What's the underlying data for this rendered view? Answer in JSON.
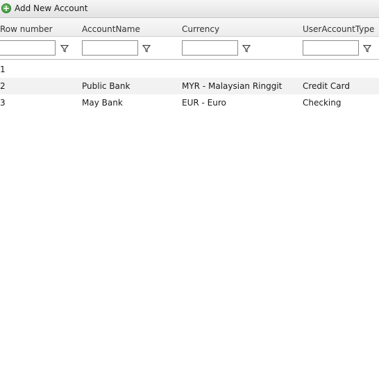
{
  "toolbar": {
    "add_label": "Add New Account",
    "add_icon": "plus-circle-icon"
  },
  "grid": {
    "columns": [
      {
        "key": "row_number",
        "label": "Row number"
      },
      {
        "key": "account_name",
        "label": "AccountName"
      },
      {
        "key": "currency",
        "label": "Currency"
      },
      {
        "key": "user_account_type",
        "label": "UserAccountType"
      }
    ],
    "filters": [
      "",
      "",
      "",
      ""
    ],
    "filter_icon": "funnel-icon",
    "rows": [
      {
        "row_number": "1",
        "account_name": "",
        "currency": "",
        "user_account_type": ""
      },
      {
        "row_number": "2",
        "account_name": "Public Bank",
        "currency": "MYR - Malaysian Ringgit",
        "user_account_type": "Credit Card"
      },
      {
        "row_number": "3",
        "account_name": "May Bank",
        "currency": "EUR - Euro",
        "user_account_type": "Checking"
      }
    ]
  },
  "colors": {
    "accent_green": "#2e8b2e",
    "alt_row": "#f2f2f2"
  }
}
